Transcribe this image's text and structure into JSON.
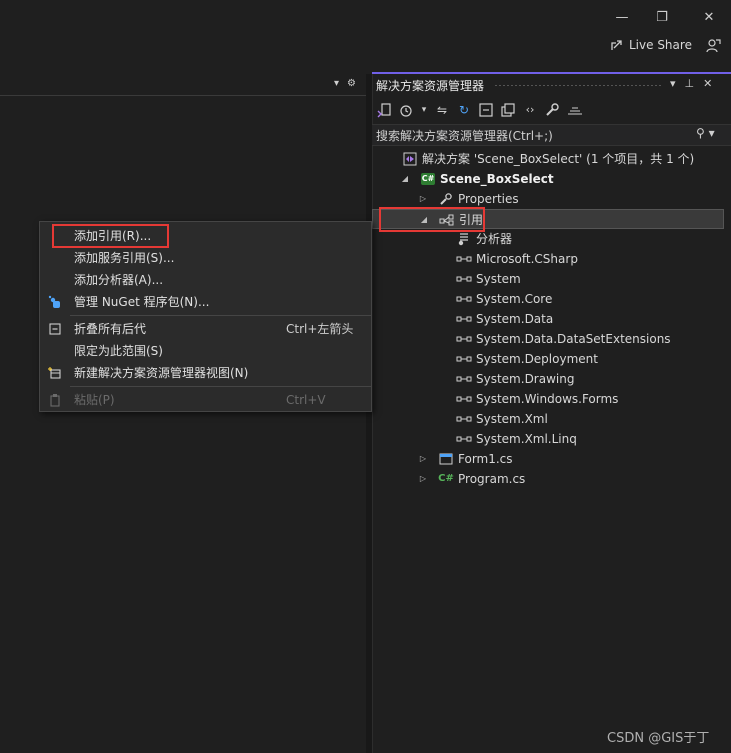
{
  "window": {
    "minimize": "—",
    "restore": "❐",
    "close": "✕"
  },
  "liveshare": {
    "label": "Live Share"
  },
  "editor": {
    "dropdown": "▾",
    "settings": "⚙"
  },
  "context_menu": {
    "items": [
      {
        "label": "添加引用(R)...",
        "icon": "",
        "shortcut": "",
        "disabled": false
      },
      {
        "label": "添加服务引用(S)...",
        "icon": "",
        "shortcut": "",
        "disabled": false
      },
      {
        "label": "添加分析器(A)...",
        "icon": "",
        "shortcut": "",
        "disabled": false
      },
      {
        "label": "管理 NuGet 程序包(N)...",
        "icon": "nuget-icon",
        "shortcut": "",
        "disabled": false
      },
      {
        "label": "折叠所有后代",
        "icon": "collapse-icon",
        "shortcut": "Ctrl+左箭头",
        "disabled": false
      },
      {
        "label": "限定为此范围(S)",
        "icon": "",
        "shortcut": "",
        "disabled": false
      },
      {
        "label": "新建解决方案资源管理器视图(N)",
        "icon": "new-view-icon",
        "shortcut": "",
        "disabled": false
      },
      {
        "label": "粘贴(P)",
        "icon": "paste-icon",
        "shortcut": "Ctrl+V",
        "disabled": true
      }
    ]
  },
  "solution_explorer": {
    "title": "解决方案资源管理器",
    "search_placeholder": "搜索解决方案资源管理器(Ctrl+;)",
    "tree": [
      {
        "label": "解决方案 'Scene_BoxSelect' (1 个项目，共 1 个)",
        "icon": "solution-icon",
        "level": 0,
        "expander": "none"
      },
      {
        "label": "Scene_BoxSelect",
        "icon": "csharp-project-icon",
        "level": 1,
        "expander": "expanded",
        "bold": true
      },
      {
        "label": "Properties",
        "icon": "wrench-icon",
        "level": 2,
        "expander": "collapsed"
      },
      {
        "label": "引用",
        "icon": "references-icon",
        "level": 2,
        "expander": "expanded",
        "selected": true
      },
      {
        "label": "分析器",
        "icon": "analyzer-icon",
        "level": 3,
        "expander": "none"
      },
      {
        "label": "Microsoft.CSharp",
        "icon": "reference-icon",
        "level": 3,
        "expander": "none"
      },
      {
        "label": "System",
        "icon": "reference-icon",
        "level": 3,
        "expander": "none"
      },
      {
        "label": "System.Core",
        "icon": "reference-icon",
        "level": 3,
        "expander": "none"
      },
      {
        "label": "System.Data",
        "icon": "reference-icon",
        "level": 3,
        "expander": "none"
      },
      {
        "label": "System.Data.DataSetExtensions",
        "icon": "reference-icon",
        "level": 3,
        "expander": "none"
      },
      {
        "label": "System.Deployment",
        "icon": "reference-icon",
        "level": 3,
        "expander": "none"
      },
      {
        "label": "System.Drawing",
        "icon": "reference-icon",
        "level": 3,
        "expander": "none"
      },
      {
        "label": "System.Windows.Forms",
        "icon": "reference-icon",
        "level": 3,
        "expander": "none"
      },
      {
        "label": "System.Xml",
        "icon": "reference-icon",
        "level": 3,
        "expander": "none"
      },
      {
        "label": "System.Xml.Linq",
        "icon": "reference-icon",
        "level": 3,
        "expander": "none"
      },
      {
        "label": "Form1.cs",
        "icon": "form-icon",
        "level": 2,
        "expander": "collapsed"
      },
      {
        "label": "Program.cs",
        "icon": "csharp-file-icon",
        "level": 2,
        "expander": "collapsed"
      }
    ]
  },
  "watermark": "CSDN @GIS于丁",
  "colors": {
    "accent": "#7160e8",
    "highlight": "#e53935",
    "csharp": "#2e7d32"
  }
}
